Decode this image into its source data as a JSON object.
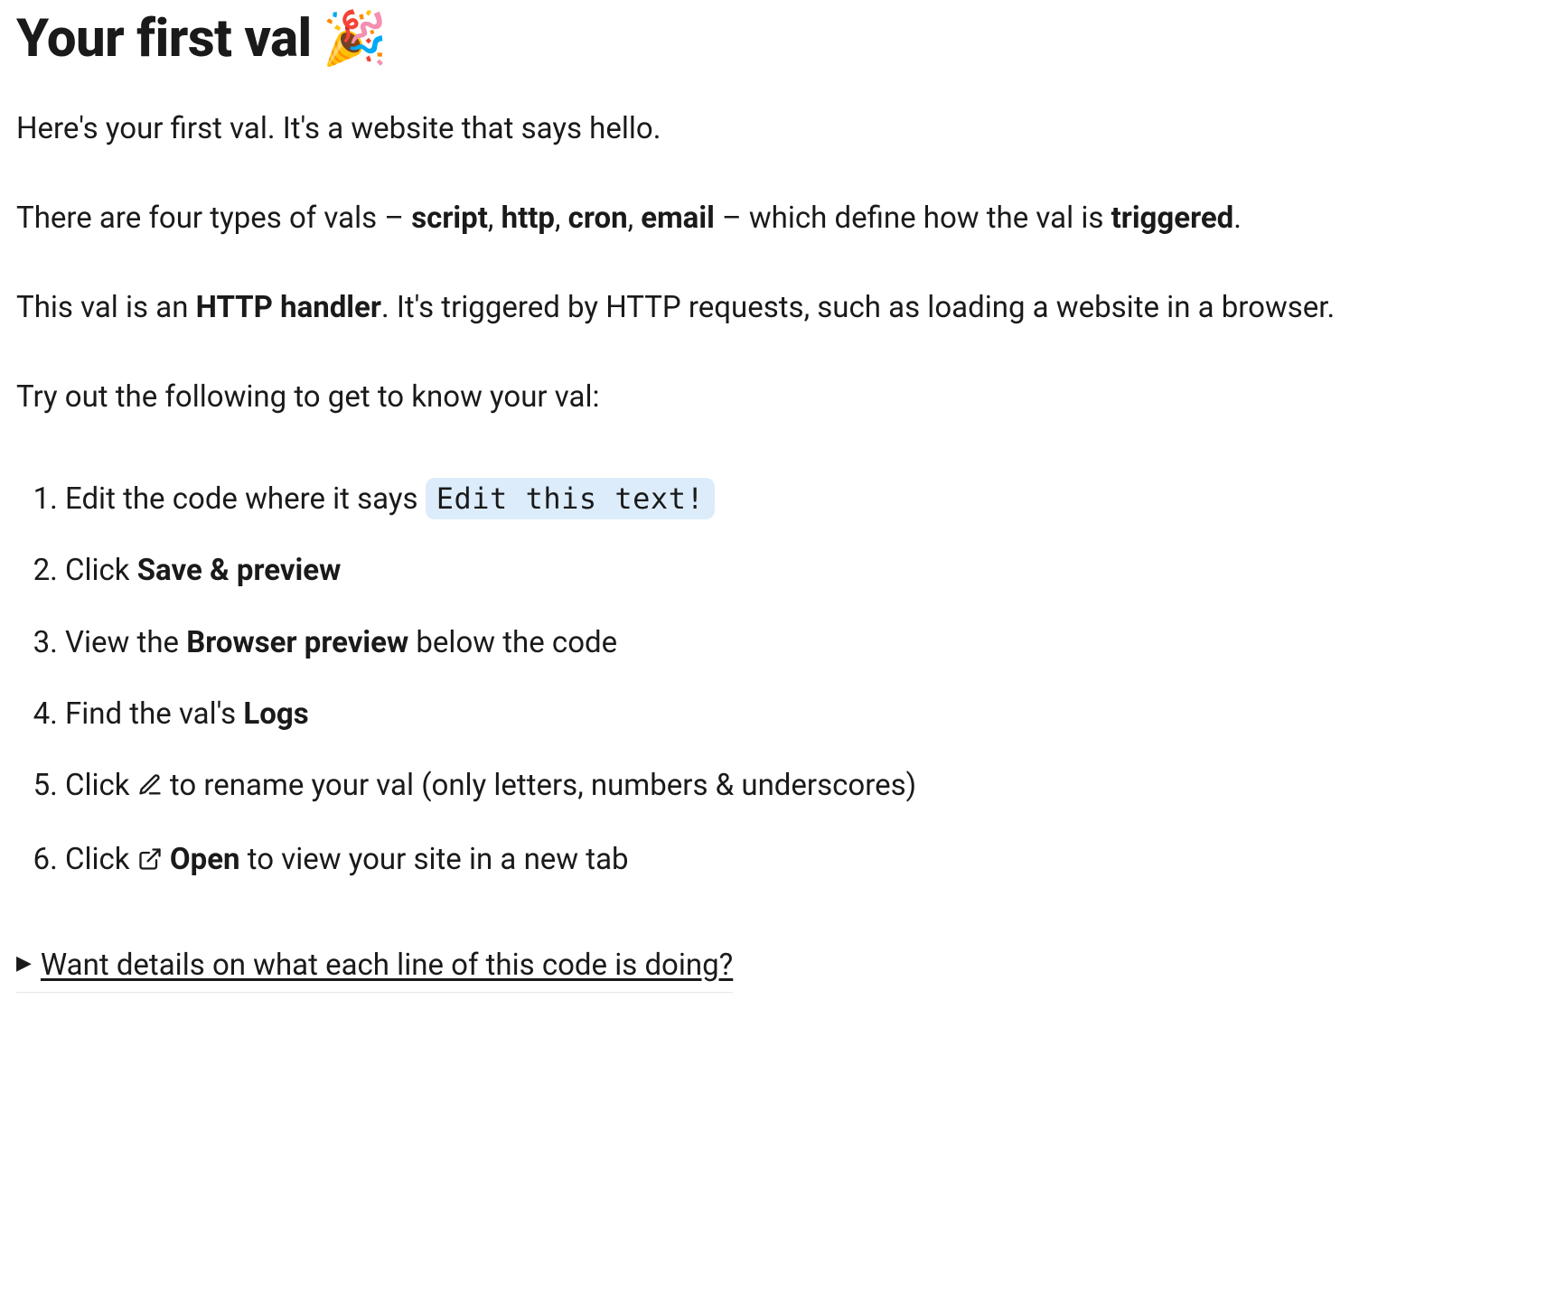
{
  "heading": {
    "text": "Your first val",
    "emoji": "🎉"
  },
  "p1": "Here's your first val. It's a website that says hello.",
  "p2": {
    "a": "There are four types of vals – ",
    "t1": "script",
    "c1": ", ",
    "t2": "http",
    "c2": ", ",
    "t3": "cron",
    "c3": ", ",
    "t4": "email",
    "b": " – which define how the val is ",
    "trig": "triggered",
    "end": "."
  },
  "p3": {
    "a": "This val is an ",
    "hh": "HTTP handler",
    "b": ". It's triggered by HTTP requests, such as loading a website in a browser."
  },
  "p4": "Try out the following to get to know your val:",
  "steps": {
    "s1": {
      "a": "Edit the code where it says ",
      "code": "Edit this text!"
    },
    "s2": {
      "a": "Click ",
      "b": "Save & preview"
    },
    "s3": {
      "a": "View the ",
      "b": "Browser preview",
      "c": " below the code"
    },
    "s4": {
      "a": "Find the val's ",
      "b": "Logs"
    },
    "s5": {
      "a": "Click ",
      "b": " to rename your val (only letters, numbers & underscores)"
    },
    "s6": {
      "a": "Click ",
      "open": "Open",
      "b": " to view your site in a new tab"
    }
  },
  "details_summary": "Want details on what each line of this code is doing?"
}
